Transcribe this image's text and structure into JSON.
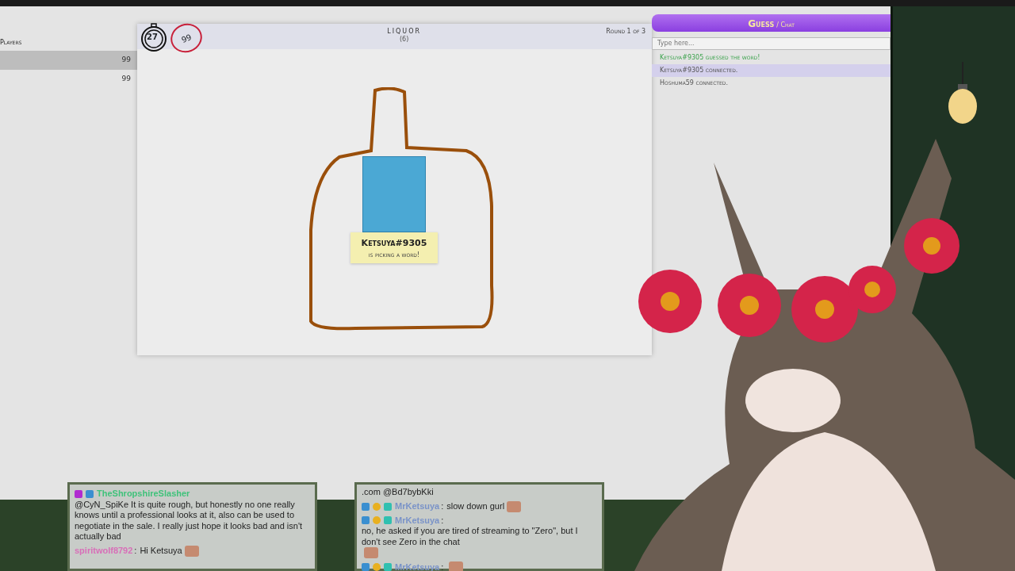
{
  "players_panel": {
    "title": "Players",
    "players": [
      {
        "score": "99",
        "selected": true
      },
      {
        "score": "99",
        "selected": false
      }
    ]
  },
  "game": {
    "timer": "27",
    "score": "99",
    "word": "LIQUOR",
    "word_hint": "(6)",
    "round": "Round 1 of 3",
    "drawer": {
      "name": "Ketsuya#9305",
      "status": "is picking a word!"
    }
  },
  "chat": {
    "title": "Guess",
    "subtitle": "/ Chat",
    "placeholder": "Type here...",
    "messages": [
      {
        "text": "Ketsuya#9305 guessed the word!",
        "kind": "correct",
        "selected": false
      },
      {
        "text": "Ketsuya#9305 connected.",
        "kind": "system",
        "selected": true
      },
      {
        "text": "Hoshuma59 connected.",
        "kind": "system",
        "selected": false
      }
    ]
  },
  "stream_chat_left": [
    {
      "kind": "vip",
      "user": "TheShropshireSlasher",
      "color": "#3fc27a",
      "text": "@CyN_SpiKe It is quite rough, but honestly no one really knows until a professional looks at it, also can be used to negotiate in the sale. I really just hope it looks bad and isn't actually bad",
      "emote": false
    },
    {
      "kind": "plain",
      "user": "spiritwolf8792",
      "color": "#d86fb8",
      "separator": ":",
      "text": "Hi Ketsuya",
      "emote": true
    }
  ],
  "stream_chat_right": [
    {
      "kind": "plain",
      "text": ".com @Bd7bybKki",
      "emote": false
    },
    {
      "kind": "mod",
      "user": "MrKetsuya",
      "color": "#7a93c8",
      "separator": ":",
      "text": "slow down gurl",
      "emote": true
    },
    {
      "kind": "mod",
      "user": "MrKetsuya",
      "color": "#7a93c8",
      "separator": ":",
      "text": "no, he asked if you are tired of streaming to \"Zero\", but I don't see Zero in the chat",
      "emote": true
    },
    {
      "kind": "mod",
      "user": "MrKetsuya",
      "color": "#7a93c8",
      "separator": ":",
      "emote": true
    }
  ]
}
